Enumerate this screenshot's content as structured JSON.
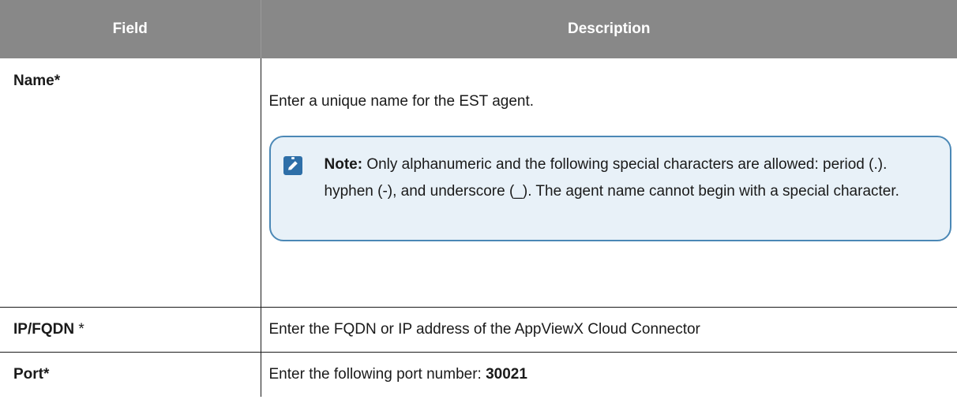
{
  "table": {
    "headers": [
      "Field",
      "Description"
    ],
    "rows": [
      {
        "field": "Name*",
        "description": "Enter a unique name for the EST agent.",
        "note": {
          "label": "Note:",
          "text": " Only alphanumeric and the following special characters are allowed: period (.). hyphen (-), and underscore (_). The agent name cannot begin with a special character."
        }
      },
      {
        "field": "IP/FQDN",
        "field_suffix": " *",
        "description": "Enter the FQDN or IP address of the AppViewX Cloud Connector"
      },
      {
        "field": "Port*",
        "description": "Enter the following port number: ",
        "value": "30021"
      }
    ]
  },
  "colors": {
    "header_bg": "#888888",
    "note_bg": "#e8f1f8",
    "note_border": "#4b88b6",
    "note_icon": "#2e6fa8"
  },
  "icons": {
    "note": "pencil-clipboard-icon"
  }
}
